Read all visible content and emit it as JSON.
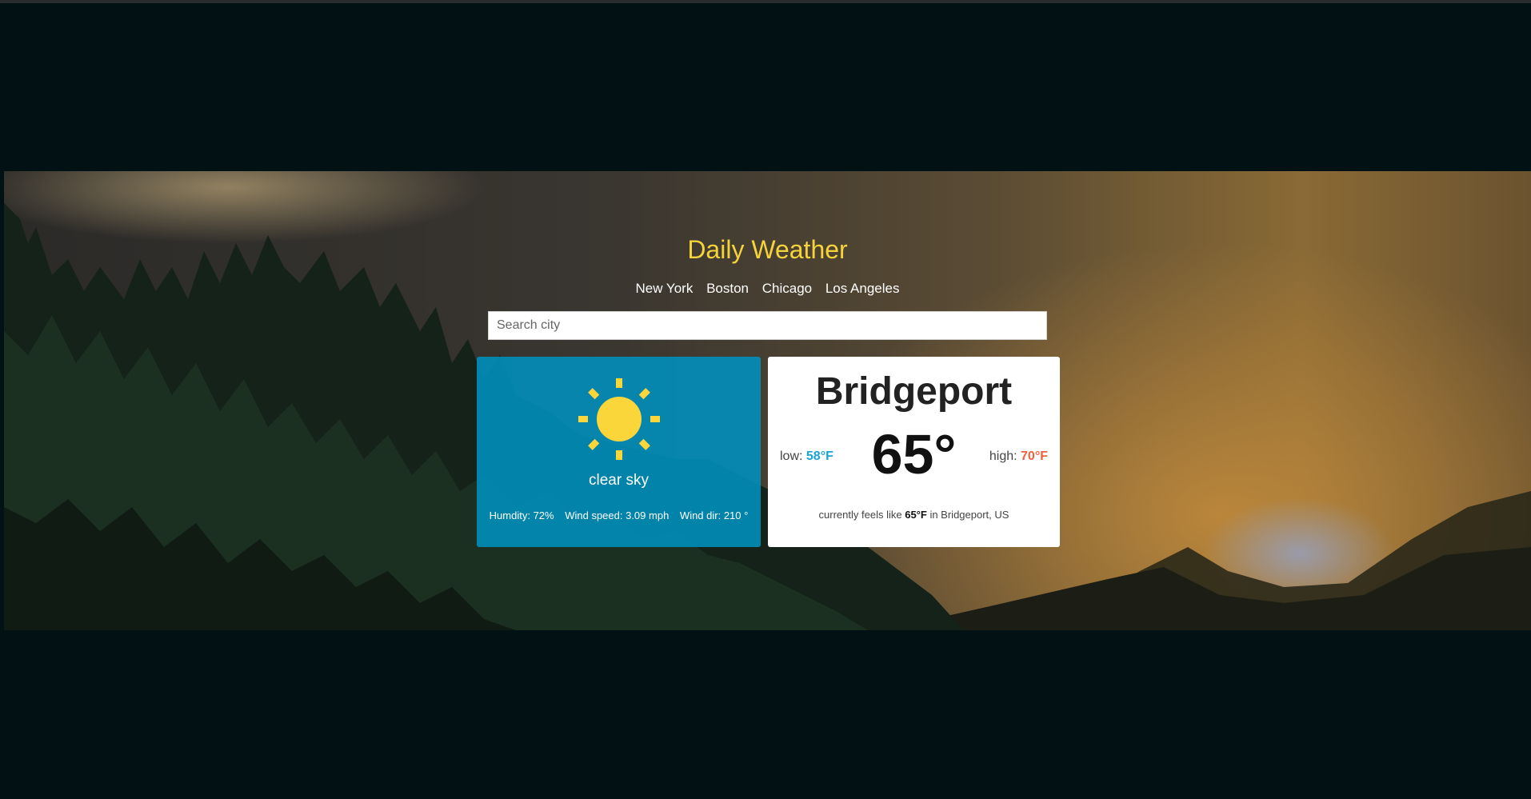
{
  "app": {
    "title": "Daily Weather"
  },
  "nav": {
    "cities": [
      "New York",
      "Boston",
      "Chicago",
      "Los Angeles"
    ]
  },
  "search": {
    "placeholder": "Search city",
    "value": ""
  },
  "conditions": {
    "icon": "sun-icon",
    "description": "clear sky",
    "humidity": "Humdity: 72%",
    "wind_speed": "Wind speed: 3.09 mph",
    "wind_dir": "Wind dir: 210 °"
  },
  "temperature": {
    "city": "Bridgeport",
    "current": "65°",
    "low_label": "low:",
    "low_value": "58°F",
    "high_label": "high:",
    "high_value": "70°F",
    "feels_prefix": "currently feels like",
    "feels_value": "65°F",
    "feels_suffix": "in Bridgeport, US"
  },
  "colors": {
    "page_background": "#021214",
    "title": "#f5d33a",
    "sky_card": "#0091be",
    "sun": "#fbd63a",
    "low_accent": "#1aa3d6",
    "high_accent": "#f0603a"
  }
}
